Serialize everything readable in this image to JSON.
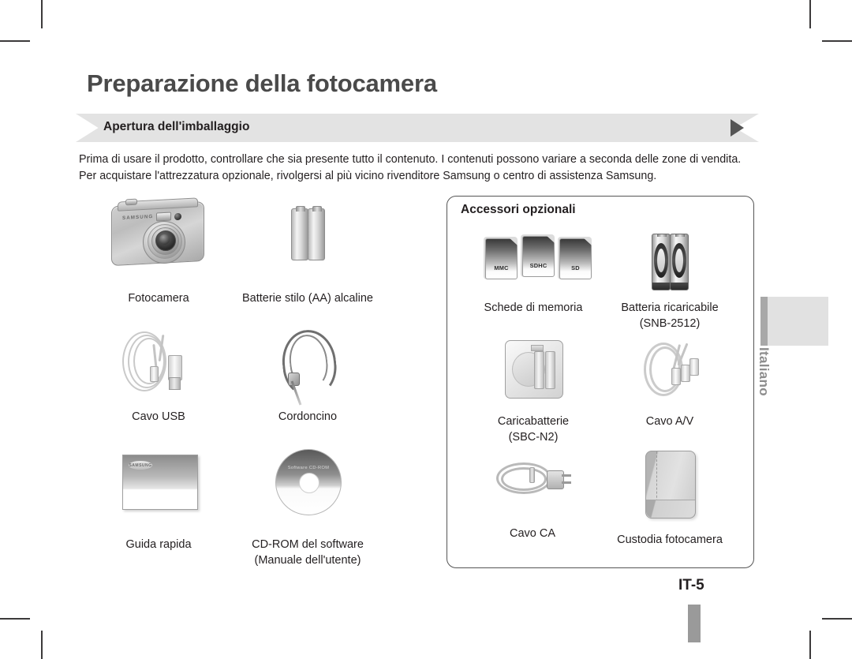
{
  "page": {
    "title": "Preparazione della fotocamera",
    "section_header": "Apertura dell'imballaggio",
    "intro": "Prima di usare il prodotto, controllare che sia presente tutto il contenuto. I contenuti possono variare a seconda delle zone di vendita. Per acquistare l'attrezzatura opzionale, rivolgersi al più vicino rivenditore Samsung o centro di assistenza Samsung.",
    "page_number": "IT-5",
    "language_tab": "Italiano"
  },
  "included_items": [
    {
      "label": "Fotocamera",
      "label2": "",
      "art": "camera",
      "brand": "SAMSUNG"
    },
    {
      "label": "Batterie stilo (AA) alcaline",
      "label2": "",
      "art": "aa-batteries"
    },
    {
      "label": "Cavo USB",
      "label2": "",
      "art": "usb-cable"
    },
    {
      "label": "Cordoncino",
      "label2": "",
      "art": "strap"
    },
    {
      "label": "Guida rapida",
      "label2": "",
      "art": "quick-guide",
      "brand": "SAMSUNG"
    },
    {
      "label": "CD-ROM del software",
      "label2": "(Manuale dell'utente)",
      "art": "cd-rom",
      "disc_text": "Software CD-ROM"
    }
  ],
  "optional_accessories": {
    "title": "Accessori opzionali",
    "items": [
      {
        "label": "Schede di memoria",
        "label2": "",
        "art": "memory-cards",
        "cards": [
          "MMC",
          "SDHC",
          "SD"
        ]
      },
      {
        "label": "Batteria ricaricabile",
        "label2": "(SNB-2512)",
        "art": "rechargeable-battery"
      },
      {
        "label": "Caricabatterie",
        "label2": "(SBC-N2)",
        "art": "battery-charger"
      },
      {
        "label": "Cavo A/V",
        "label2": "",
        "art": "av-cable"
      },
      {
        "label": "Cavo CA",
        "label2": "",
        "art": "ac-cable"
      },
      {
        "label": "Custodia fotocamera",
        "label2": "",
        "art": "camera-case"
      }
    ]
  },
  "colors": {
    "banner_bg": "#e3e3e3",
    "title_text": "#4a4a4a",
    "body_text": "#231f20",
    "tab_grey": "#8d8d8d"
  }
}
